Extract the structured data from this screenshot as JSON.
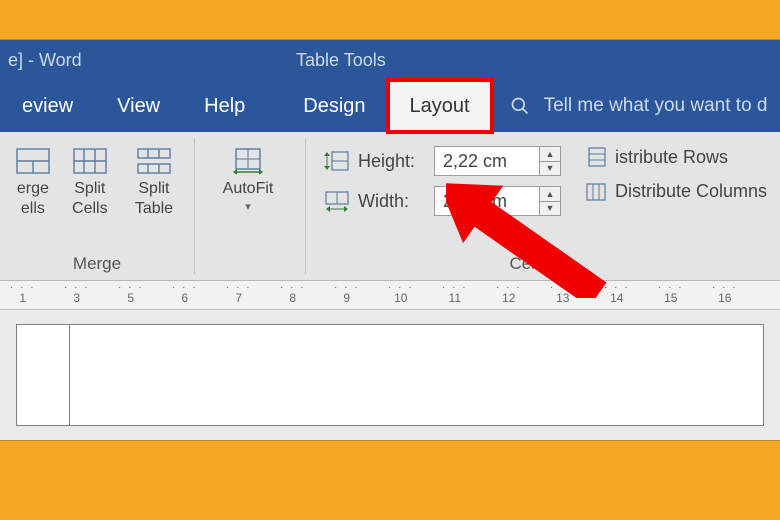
{
  "title_fragment": "e]  -  Word",
  "context_tool_tab": "Table Tools",
  "tabs": {
    "review": "eview",
    "view": "View",
    "help": "Help",
    "design": "Design",
    "layout": "Layout"
  },
  "tellme_placeholder": "Tell me what you want to d",
  "ribbon": {
    "merge": {
      "group_label": "Merge",
      "btn1_l1": "erge",
      "btn1_l2": "ells",
      "btn2_l1": "Split",
      "btn2_l2": "Cells",
      "btn3_l1": "Split",
      "btn3_l2": "Table",
      "autofit_label": "AutoFit"
    },
    "cellsize": {
      "group_label": "Cell Size",
      "height_label": "Height:",
      "height_value": "2,22 cm",
      "width_label": "Width:",
      "width_value": "2,45 cm",
      "dist_rows": "istribute Rows",
      "dist_cols": "Distribute Columns"
    }
  },
  "ruler_numbers": [
    "1",
    "3",
    "5",
    "6",
    "7",
    "8",
    "9",
    "10",
    "11",
    "12",
    "13",
    "14",
    "15",
    "16"
  ]
}
